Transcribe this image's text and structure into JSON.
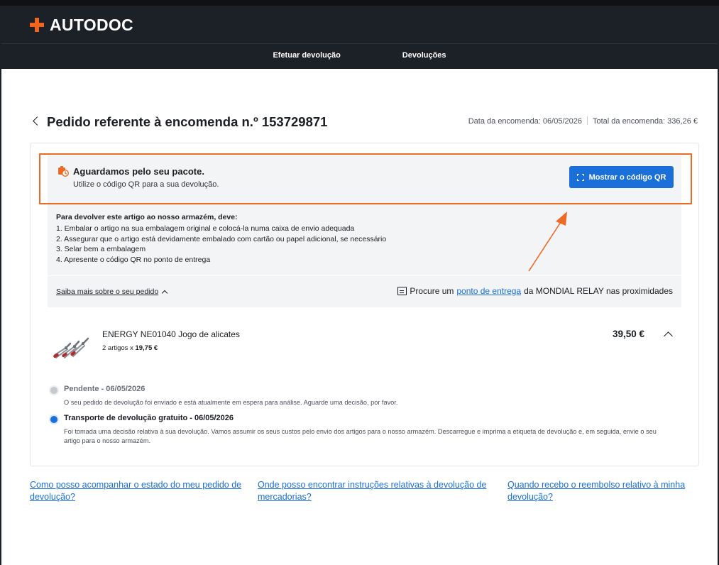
{
  "brand": {
    "name": "AUTODOC"
  },
  "nav": {
    "items": [
      "Efetuar devolução",
      "Devoluções"
    ]
  },
  "page": {
    "title": "Pedido referente à encomenda n.º 153729871",
    "order_date": "Data da encomenda: 06/05/2026",
    "order_total": "Total da encomenda: 336,26 €"
  },
  "notice": {
    "title": "Aguardamos pelo seu pacote.",
    "subtitle": "Utilize o código QR para a sua devolução.",
    "button_label": "Mostrar o código QR"
  },
  "instructions": {
    "heading": "Para devolver este artigo ao nosso armazém, deve:",
    "steps": [
      "1. Embalar o artigo na sua embalagem original e colocá-la numa caixa de envio adequada",
      "2. Assegurar que o artigo está devidamente embalado com cartão ou papel adicional, se necessário",
      "3. Selar bem a embalagem",
      "4. Apresente o código QR no ponto de entrega"
    ]
  },
  "more_link": "Saiba mais sobre o seu pedido",
  "pickup": {
    "prefix": "Procure um",
    "link": "ponto de entrega",
    "suffix": "da MONDIAL RELAY nas proximidades"
  },
  "product": {
    "name": "ENERGY NE01040 Jogo de alicates",
    "qty_prefix": "2 artigos x",
    "unit_price": "19,75 €",
    "price": "39,50 €"
  },
  "timeline": [
    {
      "title": "Pendente - 06/05/2026",
      "description": "O seu pedido de devolução foi enviado e está atualmente em espera para análise. Aguarde uma decisão, por favor.",
      "state": "done"
    },
    {
      "title": "Transporte de devolução gratuito - 06/05/2026",
      "description": "Foi tomada uma decisão relativa à sua devolução. Vamos assumir os seus custos pelo envio dos artigos para o nosso armazém. Descarregue e imprima a etiqueta de devolução e, em seguida, envie o seu artigo para o nosso armazém.",
      "state": "active"
    }
  ],
  "faq": [
    "Como posso acompanhar o estado do meu pedido de devolução?",
    "Onde posso encontrar instruções relativas à devolução de mercadorias?",
    "Quando recebo o reembolso relativo à minha devolução?"
  ],
  "colors": {
    "header_bg": "#1c2128",
    "brand_orange": "#f1641e",
    "primary_blue": "#1a6fd8",
    "highlight_orange": "#ec6a23",
    "panel_gray": "#f3f4f6"
  }
}
